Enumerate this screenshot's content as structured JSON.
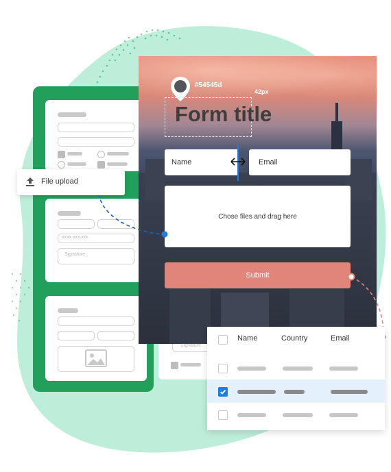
{
  "colors": {
    "accent_green": "#22a05b",
    "blob": "#bdeed9",
    "submit": "#e1847a",
    "select_blue": "#1f7de0",
    "row_highlight": "#e4f0fb"
  },
  "form": {
    "color_tag": "#54545d",
    "size_tag": "42px",
    "title": "Form title",
    "name_placeholder": "Name",
    "email_placeholder": "Email",
    "dropzone_text": "Chose files and drag here",
    "submit_label": "Submit"
  },
  "upload_callout": {
    "label": "File upload",
    "icon": "upload-icon"
  },
  "mini_cards": {
    "card2": {
      "field_text": "xxxx.xxx.xxx",
      "signature": "Signature"
    },
    "card4": {
      "signature": "Signature"
    }
  },
  "table": {
    "headers": [
      "Name",
      "Country",
      "Email"
    ],
    "rows": [
      {
        "checked": false
      },
      {
        "checked": true
      },
      {
        "checked": false
      }
    ]
  }
}
